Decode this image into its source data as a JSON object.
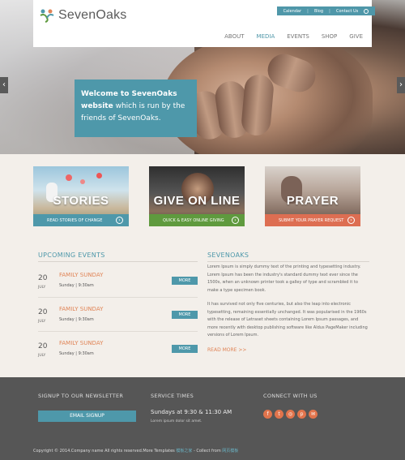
{
  "brand": {
    "name": "SevenOaks"
  },
  "toplinks": [
    "Calendar",
    "Blog",
    "Contact Us"
  ],
  "nav": [
    {
      "label": "ABOUT",
      "active": false
    },
    {
      "label": "MEDIA",
      "active": true
    },
    {
      "label": "EVENTS",
      "active": false
    },
    {
      "label": "SHOP",
      "active": false
    },
    {
      "label": "GIVE",
      "active": false
    }
  ],
  "hero": {
    "welcome_bold": "Welcome to SevenOaks website",
    "welcome_rest": " which is run by the friends of SevenOaks."
  },
  "panels": [
    {
      "title": "STORIES",
      "cta": "READ STORIES OF CHANGE",
      "bar_color": "#4e98aa"
    },
    {
      "title": "GIVE ON LINE",
      "cta": "QUICK & EASY ONLINE GIVING",
      "bar_color": "#5f9a3e"
    },
    {
      "title": "PRAYER",
      "cta": "SUBMIT YOUR PRAYER REQUEST",
      "bar_color": "#dd6e52"
    }
  ],
  "events": {
    "title": "UPCOMING EVENTS",
    "items": [
      {
        "day": "20",
        "month": "JULY",
        "name": "FAMILY SUNDAY",
        "time": "Sunday | 9:30am",
        "button": "MORE"
      },
      {
        "day": "20",
        "month": "JULY",
        "name": "FAMILY SUNDAY",
        "time": "Sunday | 9:30am",
        "button": "MORE"
      },
      {
        "day": "20",
        "month": "JULY",
        "name": "FAMILY SUNDAY",
        "time": "Sunday | 9:30am",
        "button": "MORE"
      }
    ]
  },
  "about": {
    "title": "SEVENOAKS",
    "p1": "Lorem Ipsum is simply dummy text of the printing and typesetting industry. Lorem Ipsum has been the industry's standard dummy text ever since the 1500s, when an unknown printer took a galley of type and scrambled it to make a type specimen book.",
    "p2": "It has survived not only five centuries, but also the leap into electronic typesetting, remaining essentially unchanged. It was popularised in the 1960s with the release of Letraset sheets containing Lorem Ipsum passages, and more recently with desktop publishing software like Aldus PageMaker including versions of Lorem Ipsum.",
    "read_more": "READ MORE >>"
  },
  "footer": {
    "newsletter_title": "SIGNUP TO OUR NEWSLETTER",
    "signup_button": "EMAIL SIGNUP",
    "services_title": "SERVICE TIMES",
    "service_time": "Sundays at 9:30 & 11:30 AM",
    "service_note": "Lorem ipsum dolor sit amet.",
    "connect_title": "CONNECT WITH US",
    "social_icons": [
      "facebook-icon",
      "twitter-icon",
      "instagram-icon",
      "pinterest-icon",
      "email-icon"
    ],
    "copyright_text": "Copyright © 2014.Company name All rights reserved.More Templates ",
    "copyright_link1": "模板之家",
    "copyright_mid": " - Collect from ",
    "copyright_link2": "网页模板"
  },
  "colors": {
    "accent": "#4e98aa",
    "orange": "#e08456",
    "footer": "#565656"
  }
}
